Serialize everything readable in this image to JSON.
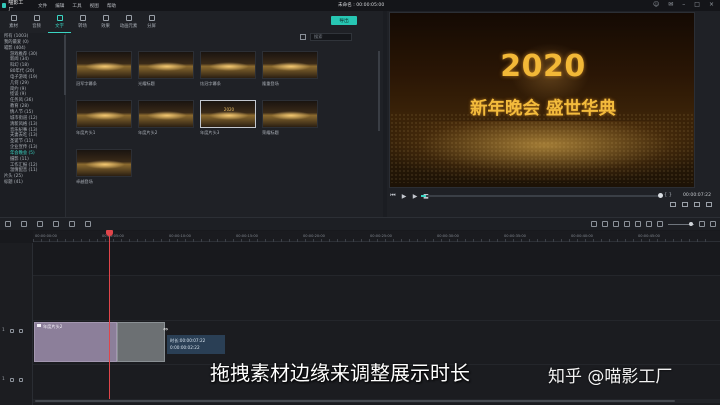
{
  "app": {
    "logo_text": "喵影工厂",
    "menu": [
      "文件",
      "编辑",
      "工具",
      "视图",
      "帮助"
    ],
    "project_title": "未命名 : 00:00:05:00"
  },
  "left_panel": {
    "tabs": [
      {
        "label": "素材"
      },
      {
        "label": "音频"
      },
      {
        "label": "文字"
      },
      {
        "label": "转场"
      },
      {
        "label": "效果"
      },
      {
        "label": "动画元素"
      },
      {
        "label": "分屏"
      }
    ],
    "active_tab": "文字",
    "export_label": "导出",
    "search_placeholder": "搜索",
    "categories": [
      {
        "label": "所有 (1003)",
        "sub": false
      },
      {
        "label": "我的最爱 (0)",
        "sub": false
      },
      {
        "label": "喵影 (404)",
        "sub": false
      },
      {
        "label": "游戏推荐 (30)",
        "sub": true
      },
      {
        "label": "新闻 (34)",
        "sub": true
      },
      {
        "label": "科幻 (18)",
        "sub": true
      },
      {
        "label": "80年代 (20)",
        "sub": true
      },
      {
        "label": "电子游戏 (19)",
        "sub": true
      },
      {
        "label": "几何 (29)",
        "sub": true
      },
      {
        "label": "简约 (9)",
        "sub": true
      },
      {
        "label": "怪谈 (9)",
        "sub": true
      },
      {
        "label": "任务风 (36)",
        "sub": true
      },
      {
        "label": "教育 (28)",
        "sub": true
      },
      {
        "label": "情人节 (15)",
        "sub": true
      },
      {
        "label": "城市街道 (12)",
        "sub": true
      },
      {
        "label": "清新风格 (13)",
        "sub": true
      },
      {
        "label": "音乐纪事 (13)",
        "sub": true
      },
      {
        "label": "夫妻去吃 (13)",
        "sub": true
      },
      {
        "label": "圣诞节 (11)",
        "sub": true
      },
      {
        "label": "企业宣传 (13)",
        "sub": true
      },
      {
        "label": "年会晚会 (5)",
        "sub": true,
        "active": true
      },
      {
        "label": "摄影 (11)",
        "sub": true
      },
      {
        "label": "工作汇报 (12)",
        "sub": true
      },
      {
        "label": "温情配音 (11)",
        "sub": true
      },
      {
        "label": "片头 (25)",
        "sub": false
      },
      {
        "label": "标题 (41)",
        "sub": false
      }
    ],
    "thumbnails": [
      {
        "caption": "冠军字幕条",
        "selected": false
      },
      {
        "caption": "光耀标题",
        "selected": false
      },
      {
        "caption": "炫冠字幕条",
        "selected": false
      },
      {
        "caption": "隆重登场",
        "selected": false
      },
      {
        "caption": "年度片头1",
        "selected": false
      },
      {
        "caption": "年度片头2",
        "selected": false
      },
      {
        "caption": "年度片头3",
        "selected": true,
        "year": "2020"
      },
      {
        "caption": "荣耀标题",
        "selected": false
      },
      {
        "caption": "卓越登场",
        "selected": false
      }
    ]
  },
  "preview": {
    "year": "2020",
    "title": "新年晚会 盛世华典",
    "timecode": "00:00:07:22",
    "progress_fraction": 0.02,
    "brackets": "{ }"
  },
  "timeline": {
    "ruler": [
      "00:00:00:00",
      "00:00:05:00",
      "00:00:10:00",
      "00:00:15:00",
      "00:00:20:00",
      "00:00:25:00",
      "00:00:30:00",
      "00:00:35:00",
      "00:00:40:00",
      "00:00:45:00"
    ],
    "tracks": [
      {
        "label": "1"
      },
      {
        "label": "1"
      }
    ],
    "clip_label": "年度片头2",
    "tooltip_duration": "时长:00:00:07:22",
    "tooltip_delta": "0:00:00:02:22"
  },
  "overlay": {
    "caption": "拖拽素材边缘来调整展示时长",
    "watermark": "知乎 @喵影工厂"
  },
  "colors": {
    "accent": "#3ad6c4",
    "export_btn": "#27c6b3",
    "playhead": "#e0454a",
    "clip": "#8c7f9a",
    "gold": "#f2b837"
  }
}
